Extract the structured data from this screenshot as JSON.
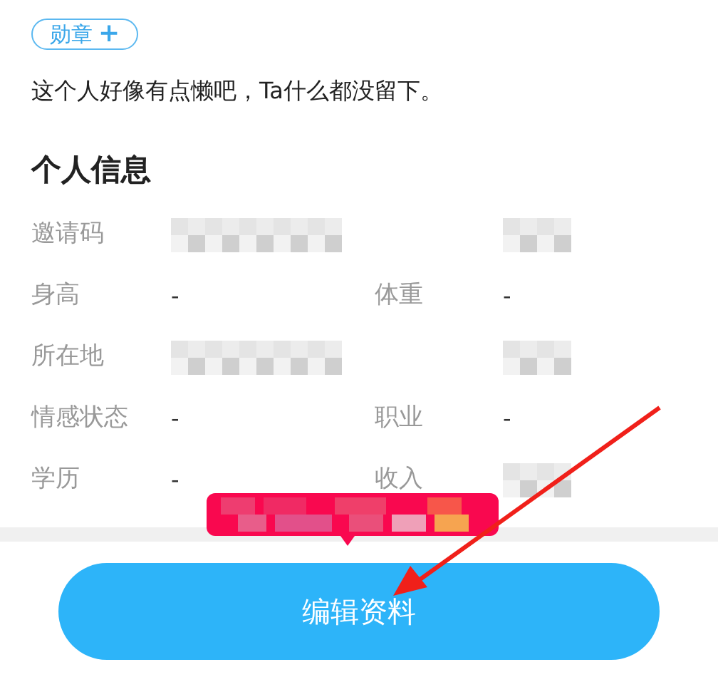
{
  "badge": {
    "label": "勋章",
    "icon": "+"
  },
  "bio": "这个人好像有点懒吧，Ta什么都没留下。",
  "section_title": "个人信息",
  "info_rows": [
    {
      "left": {
        "label": "邀请码",
        "redacted": true
      },
      "right": {
        "redacted": true
      }
    },
    {
      "left": {
        "label": "身高",
        "value": "-",
        "redacted": false
      },
      "right": {
        "label": "体重",
        "value": "-",
        "redacted": false
      }
    },
    {
      "left": {
        "label": "所在地",
        "redacted": true
      },
      "right": {
        "redacted": true
      }
    },
    {
      "left": {
        "label": "情感状态",
        "value": "-",
        "redacted": false
      },
      "right": {
        "label": "职业",
        "value": "-",
        "redacted": false
      }
    },
    {
      "left": {
        "label": "学历",
        "value": "-",
        "redacted": false
      },
      "right": {
        "label": "收入",
        "redacted": true
      }
    }
  ],
  "primary_button": "编辑资料"
}
